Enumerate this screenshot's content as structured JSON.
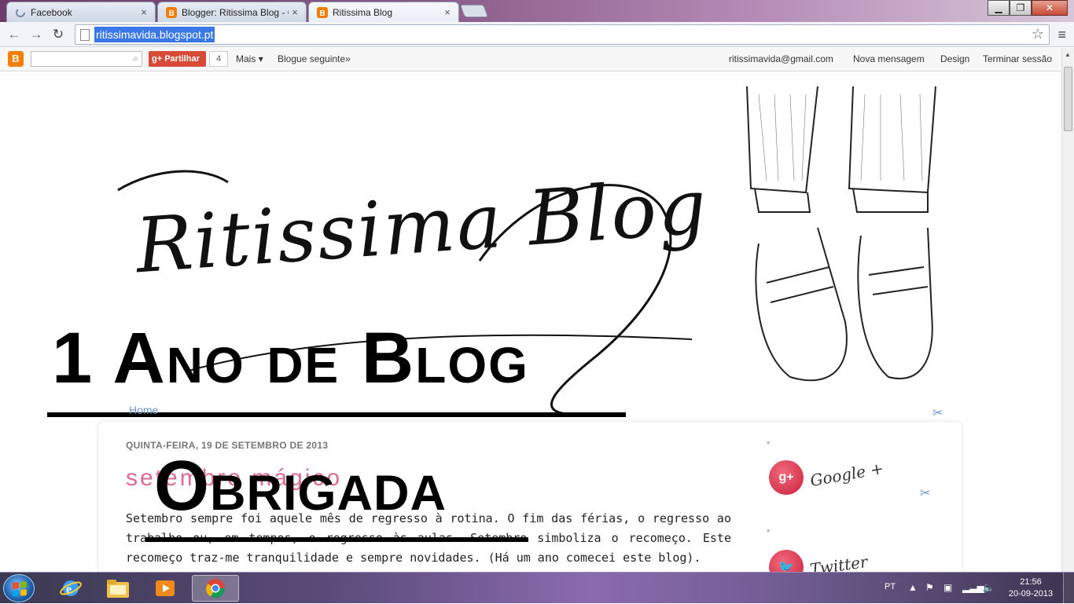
{
  "browser": {
    "tabs": [
      {
        "title": "Facebook",
        "active": false,
        "loading": true
      },
      {
        "title": "Blogger: Ritissima Blog - C",
        "active": false
      },
      {
        "title": "Ritissima Blog",
        "active": true
      }
    ],
    "url": "ritissimavida.blogspot.pt"
  },
  "blogger_nav": {
    "share_label": "Partilhar",
    "share_count": "4",
    "more_label": "Mais",
    "next_blog": "Blogue seguinte»",
    "email": "ritissimavida@gmail.com",
    "new_post": "Nova mensagem",
    "design": "Design",
    "sign_out": "Terminar sessão"
  },
  "blog": {
    "title": "Ritissima Blog",
    "overlay_line1": "1 Ano de Blog",
    "nav_home": "Home",
    "post": {
      "date": "QUINTA-FEIRA, 19 DE SETEMBRO DE 2013",
      "title": "setembro mágico",
      "overlay": "Obrigada",
      "text": "Setembro sempre foi aquele mês de regresso à rotina. O fim das férias, o regresso ao trabalho ou, em tempos, o regresso às aulas. Setembro simboliza o recomeço. Este recomeço traz-me tranquilidade e sempre novidades. (Há um ano comecei este blog)."
    },
    "sidebar": [
      {
        "icon": "google-plus-icon",
        "label": "Google +"
      },
      {
        "icon": "twitter-icon",
        "label": "Twitter"
      }
    ]
  },
  "taskbar": {
    "language": "PT",
    "time": "21:56",
    "date": "20-09-2013"
  },
  "colors": {
    "accent": "#e06a8d",
    "link": "#6b93c6",
    "share": "#d64a36",
    "url_highlight": "#3b78e7"
  }
}
